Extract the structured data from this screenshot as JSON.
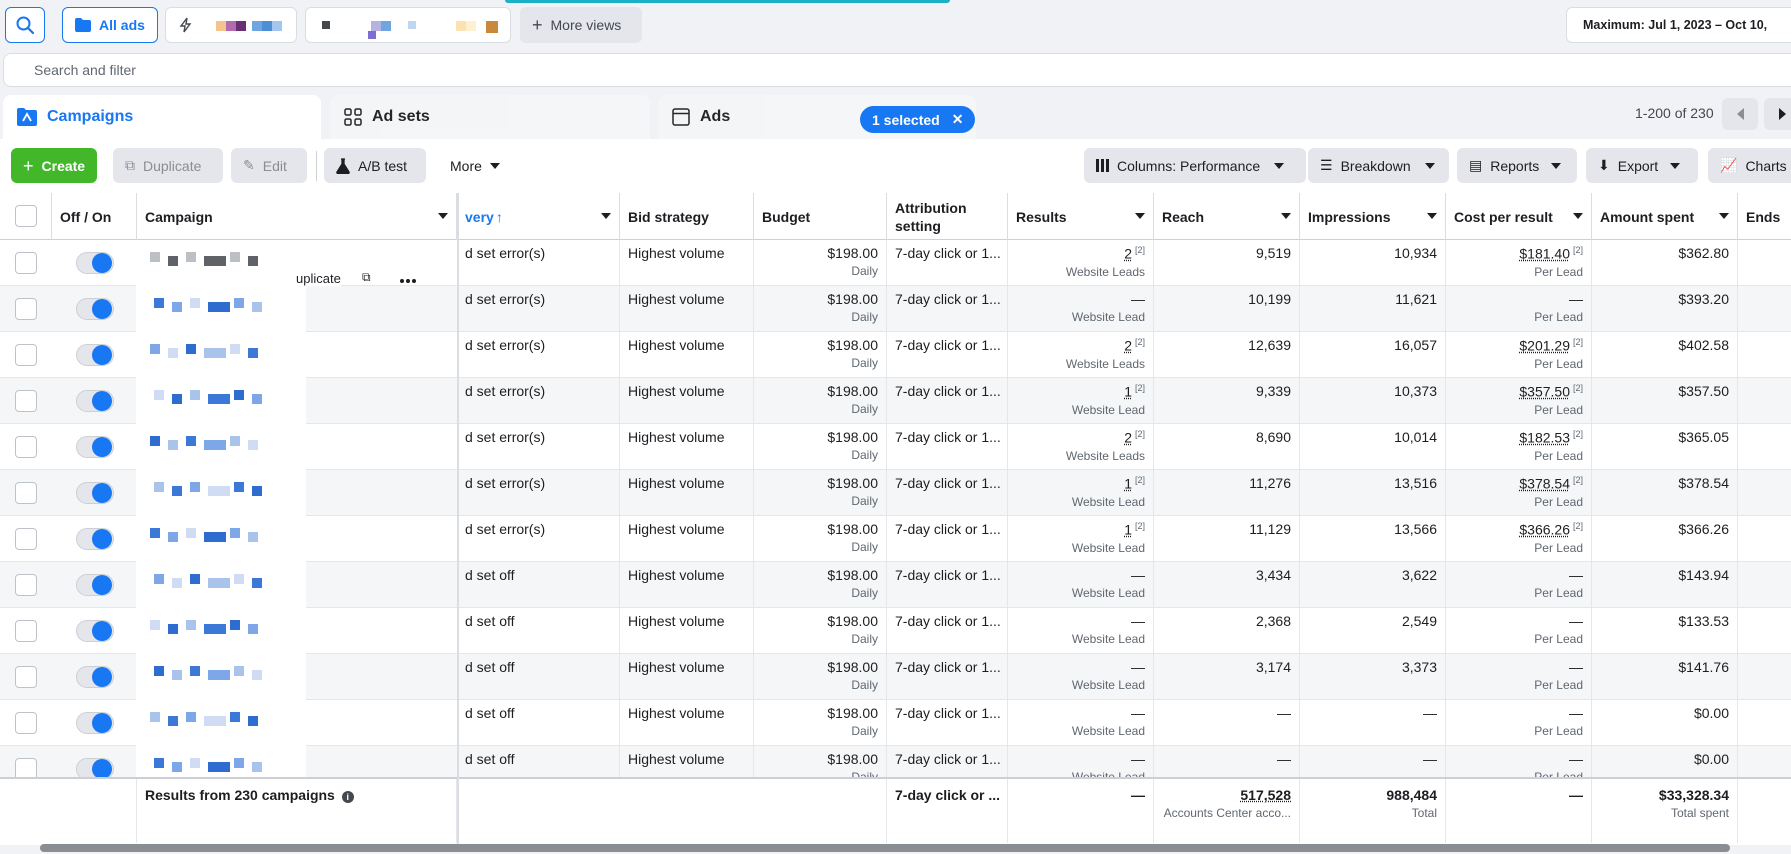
{
  "topbar": {
    "all_ads_label": "All ads",
    "more_views_label": "More views",
    "date_range": "Maximum: Jul 1, 2023 – Oct 10,"
  },
  "search": {
    "placeholder": "Search and filter"
  },
  "tabs": {
    "campaigns": "Campaigns",
    "ad_sets": "Ad sets",
    "ads": "Ads",
    "selected": "1 selected"
  },
  "pager": {
    "range": "1-200 of 230"
  },
  "toolbar": {
    "create": "Create",
    "duplicate": "Duplicate",
    "edit": "Edit",
    "ab_test": "A/B test",
    "more": "More",
    "columns": "Columns: Performance",
    "breakdown": "Breakdown",
    "reports": "Reports",
    "export": "Export",
    "charts": "Charts"
  },
  "table": {
    "headers": {
      "off_on": "Off / On",
      "campaign": "Campaign",
      "delivery": "very",
      "bid_strategy": "Bid strategy",
      "budget": "Budget",
      "attribution": "Attribution setting",
      "results": "Results",
      "reach": "Reach",
      "impressions": "Impressions",
      "cost_per_result": "Cost per result",
      "amount_spent": "Amount spent",
      "ends": "Ends"
    },
    "row_duplicate_label": "uplicate",
    "rows": [
      {
        "delivery": "d set error(s)",
        "bid": "Highest volume",
        "budget": "$198.00",
        "budget_sub": "Daily",
        "attribution": "7-day click or 1...",
        "results": "2",
        "results_fn": "[2]",
        "results_sub": "Website Leads",
        "reach": "9,519",
        "impressions": "10,934",
        "cpr": "$181.40",
        "cpr_fn": "[2]",
        "cpr_sub": "Per Lead",
        "spent": "$362.80"
      },
      {
        "delivery": "d set error(s)",
        "bid": "Highest volume",
        "budget": "$198.00",
        "budget_sub": "Daily",
        "attribution": "7-day click or 1...",
        "results": "—",
        "results_fn": "",
        "results_sub": "Website Lead",
        "reach": "10,199",
        "impressions": "11,621",
        "cpr": "—",
        "cpr_fn": "",
        "cpr_sub": "Per Lead",
        "spent": "$393.20"
      },
      {
        "delivery": "d set error(s)",
        "bid": "Highest volume",
        "budget": "$198.00",
        "budget_sub": "Daily",
        "attribution": "7-day click or 1...",
        "results": "2",
        "results_fn": "[2]",
        "results_sub": "Website Leads",
        "reach": "12,639",
        "impressions": "16,057",
        "cpr": "$201.29",
        "cpr_fn": "[2]",
        "cpr_sub": "Per Lead",
        "spent": "$402.58"
      },
      {
        "delivery": "d set error(s)",
        "bid": "Highest volume",
        "budget": "$198.00",
        "budget_sub": "Daily",
        "attribution": "7-day click or 1...",
        "results": "1",
        "results_fn": "[2]",
        "results_sub": "Website Lead",
        "reach": "9,339",
        "impressions": "10,373",
        "cpr": "$357.50",
        "cpr_fn": "[2]",
        "cpr_sub": "Per Lead",
        "spent": "$357.50"
      },
      {
        "delivery": "d set error(s)",
        "bid": "Highest volume",
        "budget": "$198.00",
        "budget_sub": "Daily",
        "attribution": "7-day click or 1...",
        "results": "2",
        "results_fn": "[2]",
        "results_sub": "Website Leads",
        "reach": "8,690",
        "impressions": "10,014",
        "cpr": "$182.53",
        "cpr_fn": "[2]",
        "cpr_sub": "Per Lead",
        "spent": "$365.05"
      },
      {
        "delivery": "d set error(s)",
        "bid": "Highest volume",
        "budget": "$198.00",
        "budget_sub": "Daily",
        "attribution": "7-day click or 1...",
        "results": "1",
        "results_fn": "[2]",
        "results_sub": "Website Lead",
        "reach": "11,276",
        "impressions": "13,516",
        "cpr": "$378.54",
        "cpr_fn": "[2]",
        "cpr_sub": "Per Lead",
        "spent": "$378.54"
      },
      {
        "delivery": "d set error(s)",
        "bid": "Highest volume",
        "budget": "$198.00",
        "budget_sub": "Daily",
        "attribution": "7-day click or 1...",
        "results": "1",
        "results_fn": "[2]",
        "results_sub": "Website Lead",
        "reach": "11,129",
        "impressions": "13,566",
        "cpr": "$366.26",
        "cpr_fn": "[2]",
        "cpr_sub": "Per Lead",
        "spent": "$366.26"
      },
      {
        "delivery": "d set off",
        "bid": "Highest volume",
        "budget": "$198.00",
        "budget_sub": "Daily",
        "attribution": "7-day click or 1...",
        "results": "—",
        "results_fn": "",
        "results_sub": "Website Lead",
        "reach": "3,434",
        "impressions": "3,622",
        "cpr": "—",
        "cpr_fn": "",
        "cpr_sub": "Per Lead",
        "spent": "$143.94"
      },
      {
        "delivery": "d set off",
        "bid": "Highest volume",
        "budget": "$198.00",
        "budget_sub": "Daily",
        "attribution": "7-day click or 1...",
        "results": "—",
        "results_fn": "",
        "results_sub": "Website Lead",
        "reach": "2,368",
        "impressions": "2,549",
        "cpr": "—",
        "cpr_fn": "",
        "cpr_sub": "Per Lead",
        "spent": "$133.53"
      },
      {
        "delivery": "d set off",
        "bid": "Highest volume",
        "budget": "$198.00",
        "budget_sub": "Daily",
        "attribution": "7-day click or 1...",
        "results": "—",
        "results_fn": "",
        "results_sub": "Website Lead",
        "reach": "3,174",
        "impressions": "3,373",
        "cpr": "—",
        "cpr_fn": "",
        "cpr_sub": "Per Lead",
        "spent": "$141.76"
      },
      {
        "delivery": "d set off",
        "bid": "Highest volume",
        "budget": "$198.00",
        "budget_sub": "Daily",
        "attribution": "7-day click or 1...",
        "results": "—",
        "results_fn": "",
        "results_sub": "Website Lead",
        "reach": "—",
        "impressions": "—",
        "cpr": "—",
        "cpr_fn": "",
        "cpr_sub": "Per Lead",
        "spent": "$0.00"
      },
      {
        "delivery": "d set off",
        "bid": "Highest volume",
        "budget": "$198.00",
        "budget_sub": "Daily",
        "attribution": "7-day click or 1...",
        "results": "—",
        "results_fn": "",
        "results_sub": "Website Lead",
        "reach": "—",
        "impressions": "—",
        "cpr": "—",
        "cpr_fn": "",
        "cpr_sub": "Per Lead",
        "spent": "$0.00"
      }
    ],
    "footer": {
      "label": "Results from 230 campaigns",
      "attribution": "7-day click or ...",
      "results": "—",
      "reach": "517,528",
      "reach_sub": "Accounts Center acco...",
      "impressions": "988,484",
      "impressions_sub": "Total",
      "cpr": "—",
      "spent": "$33,328.34",
      "spent_sub": "Total spent"
    }
  },
  "colors": {
    "accent": "#1877f2",
    "create": "#42b72a",
    "notify": "#1cb0c6"
  }
}
